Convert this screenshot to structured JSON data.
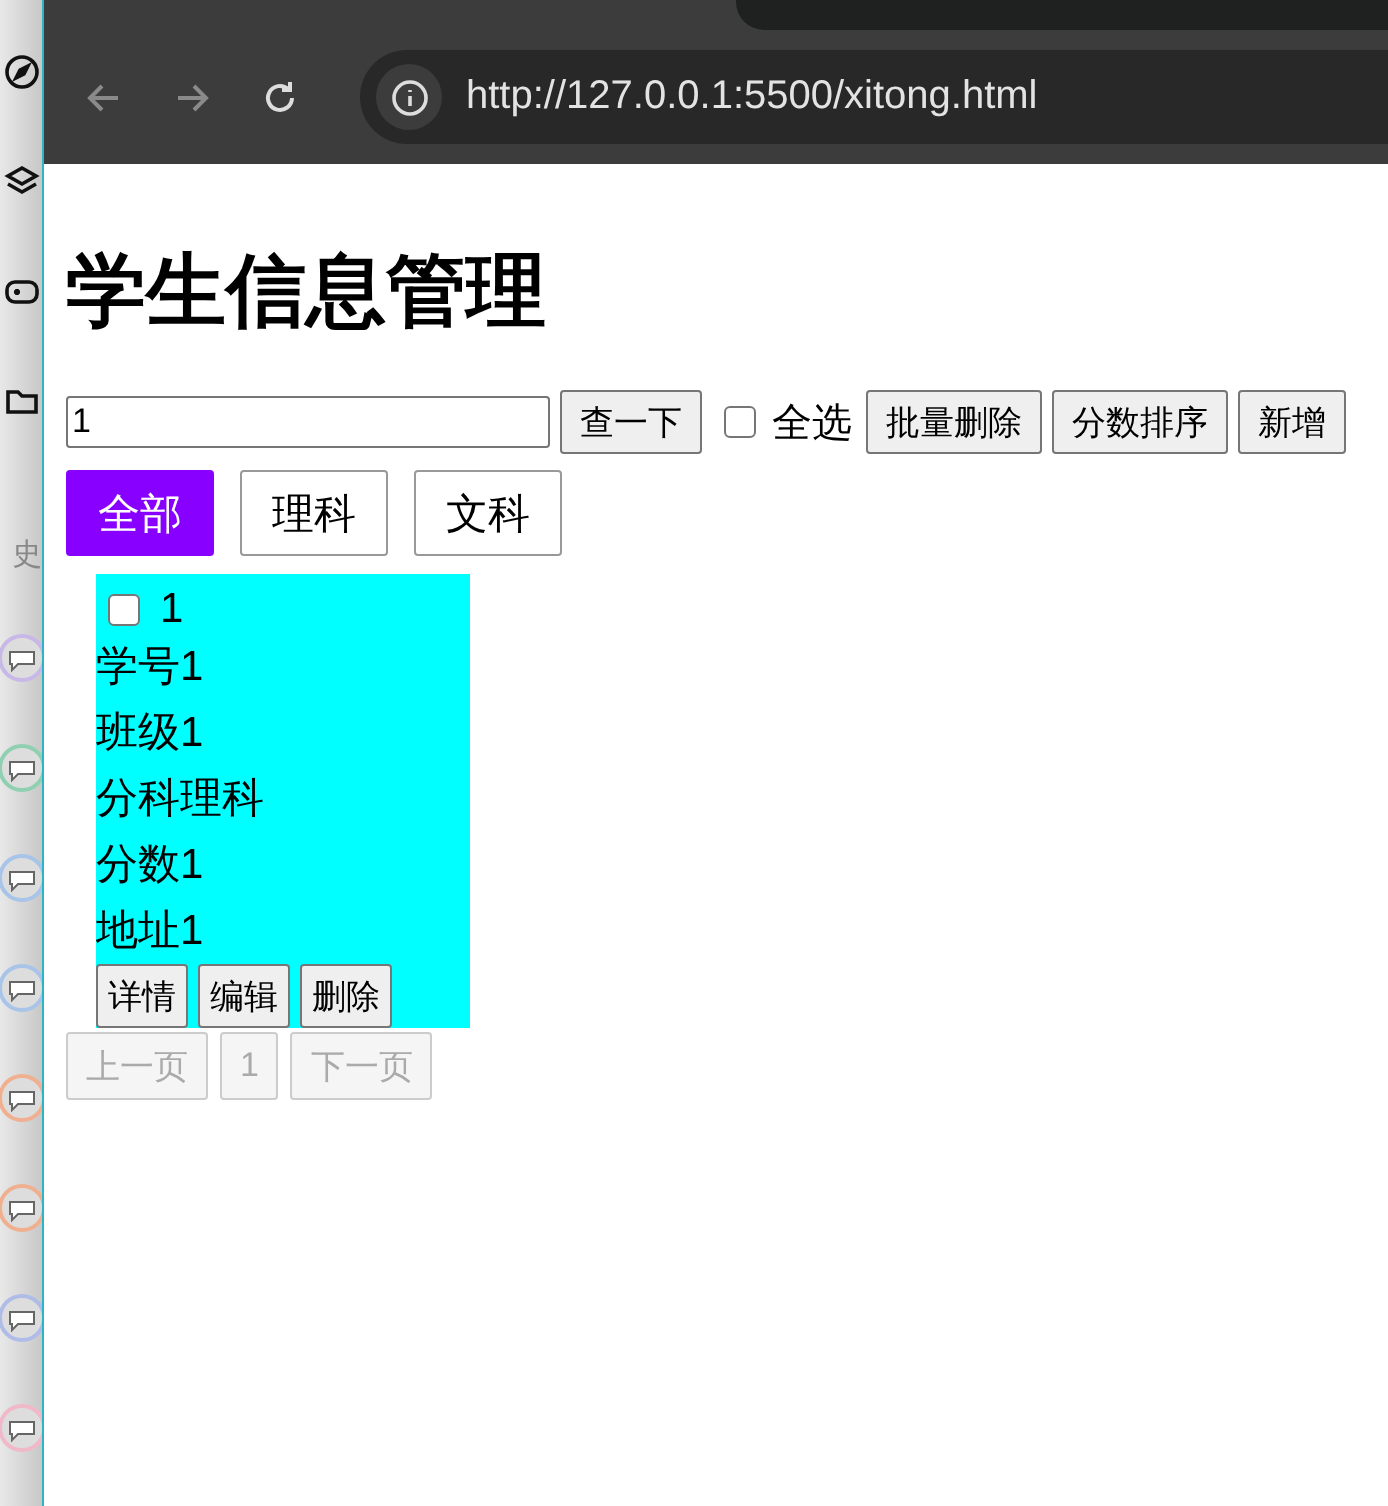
{
  "browser": {
    "url": "http://127.0.0.1:5500/xitong.html"
  },
  "side_panel": {
    "label": "史"
  },
  "page": {
    "title": "学生信息管理",
    "search": {
      "value": "1"
    },
    "toolbar": [
      {
        "kind": "button",
        "label": "查一下"
      },
      {
        "kind": "checkbox",
        "label": "全选",
        "checked": false
      },
      {
        "kind": "button",
        "label": "批量删除"
      },
      {
        "kind": "button",
        "label": "分数排序"
      },
      {
        "kind": "button",
        "label": "新增"
      }
    ],
    "filters": [
      {
        "label": "全部",
        "selected": true
      },
      {
        "label": "理科",
        "selected": false
      },
      {
        "label": "文科",
        "selected": false
      }
    ],
    "cards": [
      {
        "checked": false,
        "index": "1",
        "lines": [
          "学号1",
          "班级1",
          "分科理科",
          "分数1",
          "地址1"
        ],
        "actions": [
          "详情",
          "编辑",
          "删除"
        ]
      }
    ],
    "pagination": [
      {
        "label": "上一页",
        "disabled": true
      },
      {
        "label": "1",
        "disabled": true
      },
      {
        "label": "下一页",
        "disabled": true
      }
    ]
  }
}
